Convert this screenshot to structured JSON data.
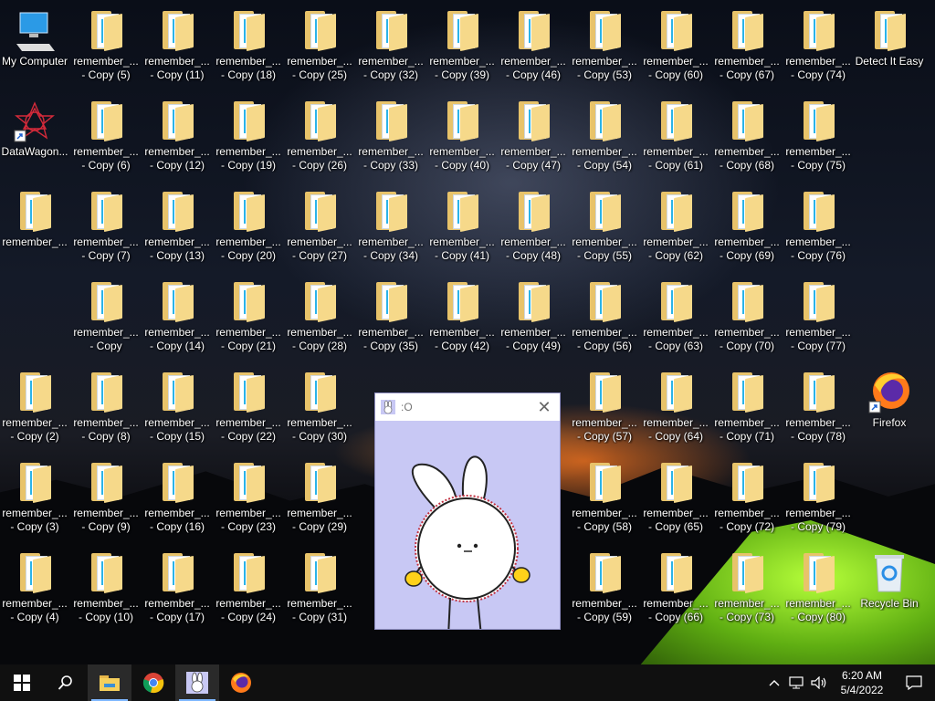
{
  "desktop": {
    "icons": [
      {
        "label": "My Computer",
        "type": "computer"
      },
      {
        "label": "DataWagon...",
        "type": "datawagon"
      },
      {
        "label": "remember_...",
        "type": "folder-open"
      },
      {
        "label": "remember_...",
        "type": "folder"
      },
      {
        "label": "remember_...\n- Copy (2)",
        "type": "folder"
      },
      {
        "label": "remember_...\n- Copy (3)",
        "type": "folder"
      },
      {
        "label": "remember_...\n- Copy (4)",
        "type": "folder"
      },
      {
        "label": "remember_...\n- Copy (5)",
        "type": "folder"
      },
      {
        "label": "remember_...\n- Copy (6)",
        "type": "folder"
      },
      {
        "label": "remember_...\n- Copy (7)",
        "type": "folder"
      },
      {
        "label": "remember_...\n- Copy",
        "type": "folder"
      },
      {
        "label": "remember_...\n- Copy (8)",
        "type": "folder"
      },
      {
        "label": "remember_...\n- Copy (9)",
        "type": "folder"
      },
      {
        "label": "remember_...\n- Copy (10)",
        "type": "folder"
      },
      {
        "label": "remember_...\n- Copy (11)",
        "type": "folder"
      },
      {
        "label": "remember_...\n- Copy (12)",
        "type": "folder"
      },
      {
        "label": "remember_...\n- Copy (13)",
        "type": "folder"
      },
      {
        "label": "remember_...\n- Copy (14)",
        "type": "folder"
      },
      {
        "label": "remember_...\n- Copy (15)",
        "type": "folder"
      },
      {
        "label": "remember_...\n- Copy (16)",
        "type": "folder"
      },
      {
        "label": "remember_...\n- Copy (17)",
        "type": "folder"
      },
      {
        "label": "remember_...\n- Copy (18)",
        "type": "folder"
      },
      {
        "label": "remember_...\n- Copy (19)",
        "type": "folder"
      },
      {
        "label": "remember_...\n- Copy (20)",
        "type": "folder"
      },
      {
        "label": "remember_...\n- Copy (21)",
        "type": "folder"
      },
      {
        "label": "remember_...\n- Copy (22)",
        "type": "folder"
      },
      {
        "label": "remember_...\n- Copy (23)",
        "type": "folder"
      },
      {
        "label": "remember_...\n- Copy (24)",
        "type": "folder"
      },
      {
        "label": "remember_...\n- Copy (25)",
        "type": "folder"
      },
      {
        "label": "remember_...\n- Copy (26)",
        "type": "folder"
      },
      {
        "label": "remember_...\n- Copy (27)",
        "type": "folder"
      },
      {
        "label": "remember_...\n- Copy (28)",
        "type": "folder"
      },
      {
        "label": "remember_...\n- Copy (30)",
        "type": "folder"
      },
      {
        "label": "remember_...\n- Copy (29)",
        "type": "folder"
      },
      {
        "label": "remember_...\n- Copy (31)",
        "type": "folder"
      },
      {
        "label": "remember_...\n- Copy (32)",
        "type": "folder"
      },
      {
        "label": "remember_...\n- Copy (33)",
        "type": "folder"
      },
      {
        "label": "remember_...\n- Copy (34)",
        "type": "folder"
      },
      {
        "label": "remember_...\n- Copy (35)",
        "type": "folder"
      },
      {
        "label": "remember_...\n- Copy (39)",
        "type": "folder"
      },
      {
        "label": "remember_...\n- Copy (40)",
        "type": "folder"
      },
      {
        "label": "remember_...\n- Copy (41)",
        "type": "folder"
      },
      {
        "label": "remember_...\n- Copy (42)",
        "type": "folder"
      },
      {
        "label": "remember_...\n- Copy (46)",
        "type": "folder"
      },
      {
        "label": "remember_...\n- Copy (47)",
        "type": "folder"
      },
      {
        "label": "remember_...\n- Copy (48)",
        "type": "folder"
      },
      {
        "label": "remember_...\n- Copy (49)",
        "type": "folder"
      },
      {
        "label": "remember_...\n- Copy (53)",
        "type": "folder"
      },
      {
        "label": "remember_...\n- Copy (54)",
        "type": "folder"
      },
      {
        "label": "remember_...\n- Copy (55)",
        "type": "folder"
      },
      {
        "label": "remember_...\n- Copy (56)",
        "type": "folder"
      },
      {
        "label": "remember_...\n- Copy (57)",
        "type": "folder"
      },
      {
        "label": "remember_...\n- Copy (58)",
        "type": "folder"
      },
      {
        "label": "remember_...\n- Copy (59)",
        "type": "folder"
      },
      {
        "label": "remember_...\n- Copy (60)",
        "type": "folder"
      },
      {
        "label": "remember_...\n- Copy (61)",
        "type": "folder"
      },
      {
        "label": "remember_...\n- Copy (62)",
        "type": "folder"
      },
      {
        "label": "remember_...\n- Copy (63)",
        "type": "folder"
      },
      {
        "label": "remember_...\n- Copy (64)",
        "type": "folder"
      },
      {
        "label": "remember_...\n- Copy (65)",
        "type": "folder"
      },
      {
        "label": "remember_...\n- Copy (66)",
        "type": "folder"
      },
      {
        "label": "remember_...\n- Copy (67)",
        "type": "folder"
      },
      {
        "label": "remember_...\n- Copy (68)",
        "type": "folder"
      },
      {
        "label": "remember_...\n- Copy (69)",
        "type": "folder"
      },
      {
        "label": "remember_...\n- Copy (70)",
        "type": "folder"
      },
      {
        "label": "remember_...\n- Copy (71)",
        "type": "folder"
      },
      {
        "label": "remember_...\n- Copy (72)",
        "type": "folder"
      },
      {
        "label": "remember_...\n- Copy (73)",
        "type": "folder"
      },
      {
        "label": "remember_...\n- Copy (74)",
        "type": "folder"
      },
      {
        "label": "remember_...\n- Copy (75)",
        "type": "folder"
      },
      {
        "label": "remember_...\n- Copy (76)",
        "type": "folder"
      },
      {
        "label": "remember_...\n- Copy (77)",
        "type": "folder"
      },
      {
        "label": "remember_...\n- Copy (78)",
        "type": "folder"
      },
      {
        "label": "remember_...\n- Copy (79)",
        "type": "folder"
      },
      {
        "label": "remember_...\n- Copy (80)",
        "type": "folder"
      },
      {
        "label": "Detect It Easy",
        "type": "folder-plain"
      },
      {
        "label": "Firefox",
        "type": "firefox"
      },
      {
        "label": "Recycle Bin",
        "type": "recycle"
      }
    ]
  },
  "popup": {
    "title": ":O",
    "close_glyph": "✕",
    "background": "#c8c8f4"
  },
  "taskbar": {
    "start_icon": "windows-logo-icon",
    "search_icon": "search-icon",
    "apps": [
      {
        "name": "file-explorer-icon",
        "active": true
      },
      {
        "name": "chrome-icon",
        "active": false
      },
      {
        "name": "bunny-app-icon",
        "active": true
      },
      {
        "name": "firefox-icon",
        "active": false
      }
    ],
    "time": "6:20 AM",
    "date": "5/4/2022",
    "tray_icons": [
      "chevron-up-icon",
      "network-icon",
      "volume-icon",
      "notification-icon"
    ]
  }
}
